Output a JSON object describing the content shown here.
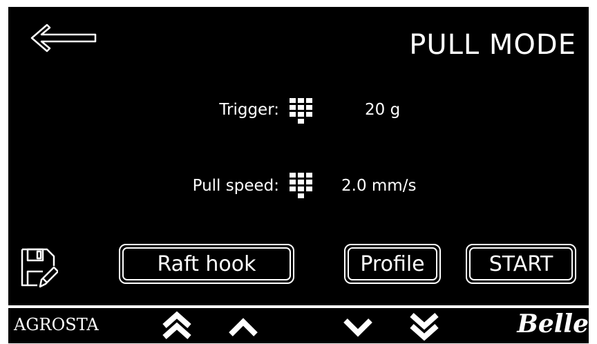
{
  "header": {
    "back_icon": "arrow-left-outline-icon",
    "title": "PULL MODE"
  },
  "parameters": [
    {
      "label": "Trigger:",
      "value": "20 g",
      "keypad_icon": "keypad-icon"
    },
    {
      "label": "Pull speed:",
      "value": "2.0 mm/s",
      "keypad_icon": "keypad-icon"
    }
  ],
  "actions": {
    "save_icon": "floppy-disk-edit-icon",
    "raft_hook_label": "Raft hook",
    "profile_label": "Profile",
    "start_label": "START"
  },
  "footer": {
    "brand_left": "AGROSTA",
    "brand_right": "Belle",
    "nav_icons": [
      "double-chevron-up-icon",
      "chevron-up-icon",
      "chevron-down-icon",
      "double-chevron-down-icon"
    ]
  },
  "colors": {
    "background": "#000000",
    "foreground": "#ffffff",
    "frame": "#ffffff"
  }
}
